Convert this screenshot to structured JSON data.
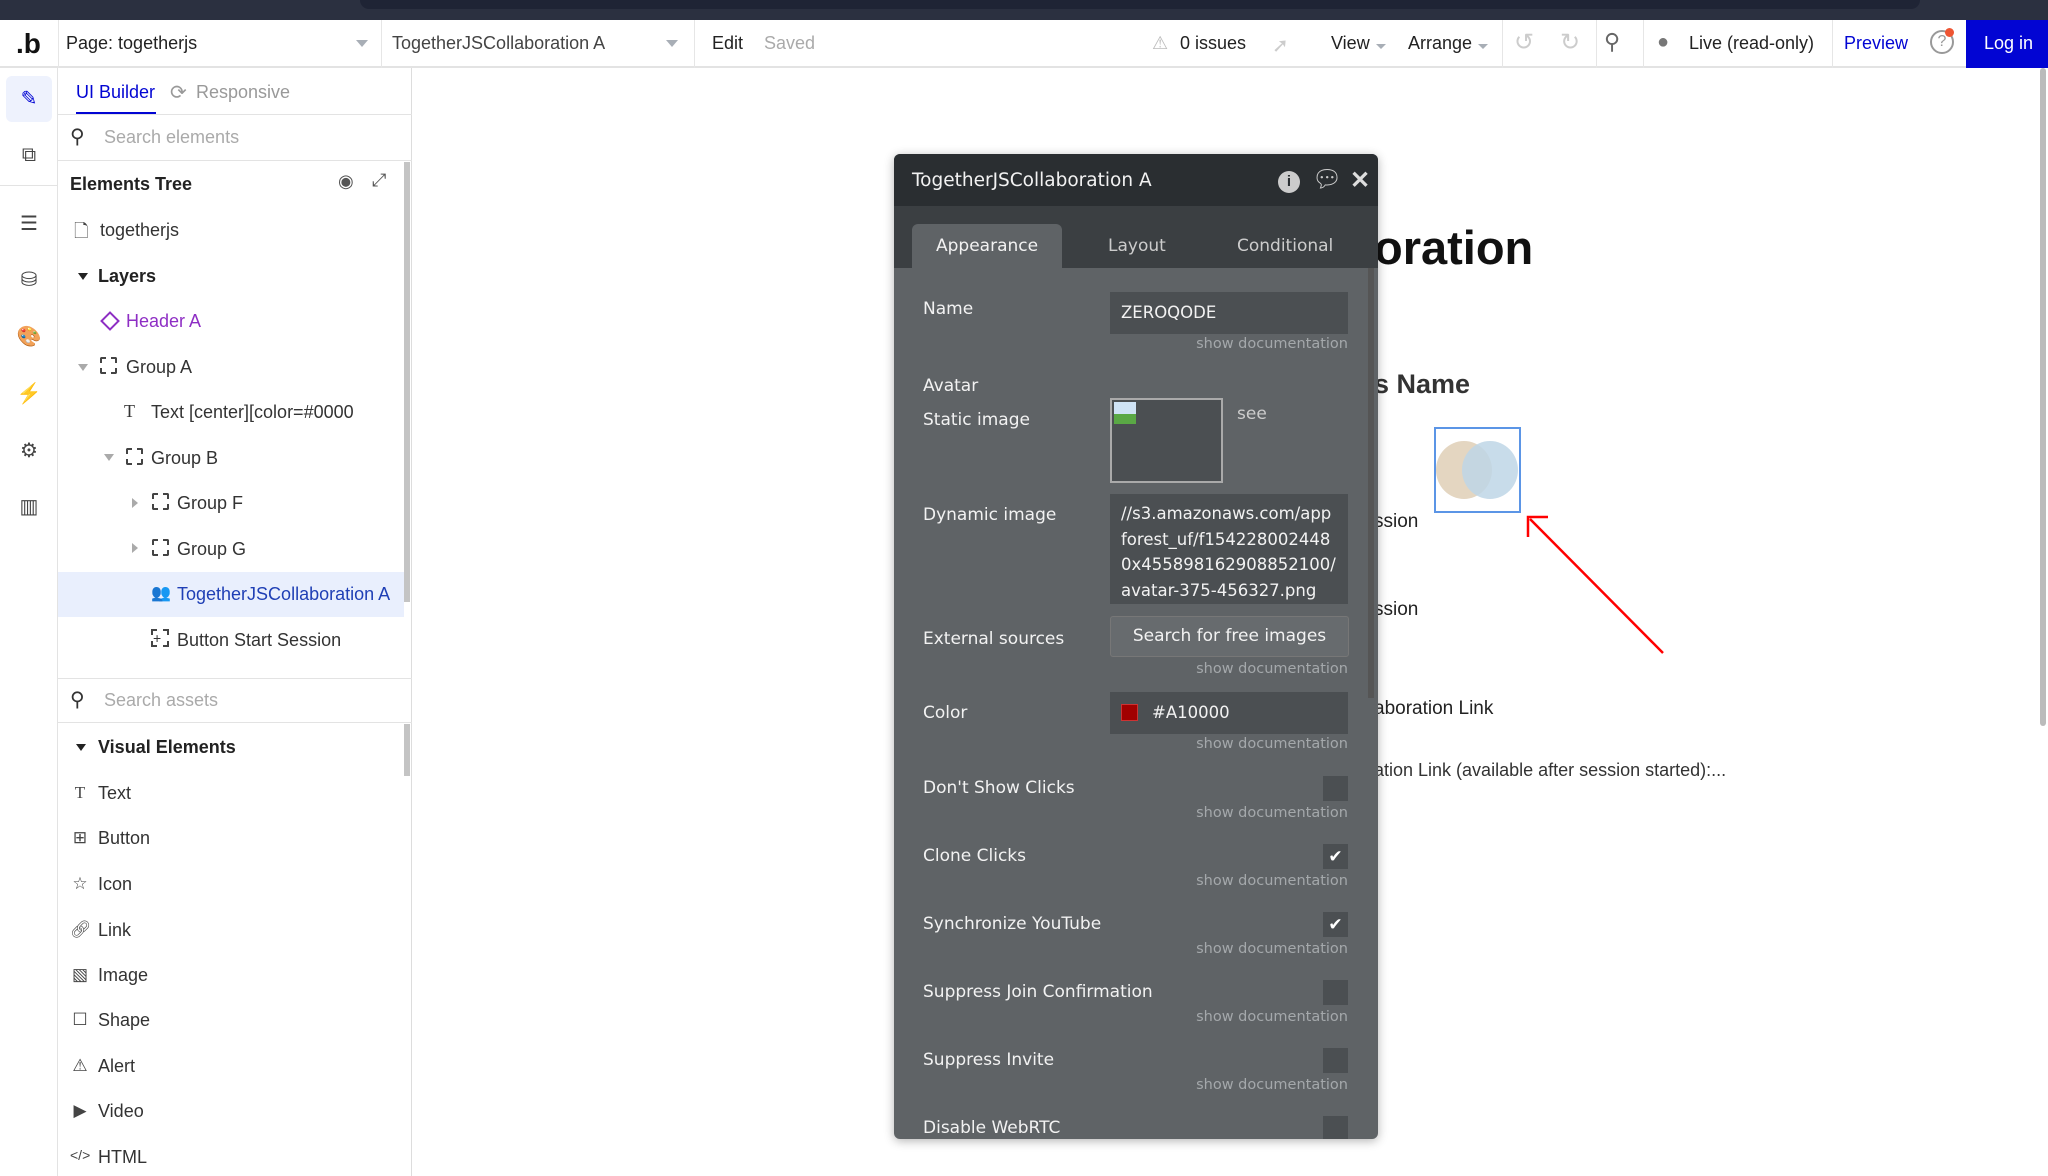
{
  "header": {
    "page_selector": "Page: togetherjs",
    "element_selector": "TogetherJSCollaboration A",
    "edit": "Edit",
    "saved": "Saved",
    "issues": "0 issues",
    "view": "View",
    "arrange": "Arrange",
    "live": "Live (read-only)",
    "preview": "Preview",
    "login": "Log in",
    "brand_color": "#0205D3",
    "preview_color": "#0205D3"
  },
  "left_panel": {
    "tabs": [
      "UI Builder",
      "Responsive"
    ],
    "search_elements_placeholder": "Search elements",
    "tree_title": "Elements Tree",
    "tree": [
      {
        "label": "togetherjs",
        "icon": "page-icon"
      },
      {
        "label": "Layers",
        "icon": "caret-down-icon"
      },
      {
        "label": "Header A",
        "icon": "reusable-diamond-icon"
      },
      {
        "label": "Group A",
        "icon": "group-icon"
      },
      {
        "label": "Text [center][color=#0000",
        "icon": "text-icon"
      },
      {
        "label": "Group B",
        "icon": "group-icon"
      },
      {
        "label": "Group F",
        "icon": "group-icon"
      },
      {
        "label": "Group G",
        "icon": "group-icon"
      },
      {
        "label": "TogetherJSCollaboration A",
        "icon": "users-icon",
        "selected": true
      },
      {
        "label": "Button Start Session",
        "icon": "button-icon"
      }
    ],
    "search_assets_placeholder": "Search assets",
    "visual_elements_title": "Visual Elements",
    "visual_elements": [
      "Text",
      "Button",
      "Icon",
      "Link",
      "Image",
      "Shape",
      "Alert",
      "Video",
      "HTML"
    ]
  },
  "canvas": {
    "title_fragment": "oration",
    "name_fragment": "s Name",
    "session_fragment_1": "ssion",
    "session_fragment_2": "ssion",
    "link_fragment": "aboration Link",
    "link_info_fragment": "ation Link (available after session started):..."
  },
  "dialog": {
    "title": "TogetherJSCollaboration A",
    "tabs": [
      "Appearance",
      "Layout",
      "Conditional"
    ],
    "active_tab": "Appearance",
    "doc_label": "show documentation",
    "name_label": "Name",
    "name_value": "ZEROQODE",
    "avatar_label": "Avatar",
    "static_image_label": "Static image",
    "see_label": "see",
    "dynamic_image_label": "Dynamic image",
    "dynamic_image_value": "//s3.amazonaws.com/appforest_uf/f1542280024480x455898162908852100/avatar-375-456327.png",
    "external_sources_label": "External sources",
    "search_images_button": "Search for free images",
    "color_label": "Color",
    "color_value": "#A10000",
    "checkboxes": [
      {
        "label": "Don't Show Clicks",
        "checked": false
      },
      {
        "label": "Clone Clicks",
        "checked": true
      },
      {
        "label": "Synchronize YouTube",
        "checked": true
      },
      {
        "label": "Suppress Join Confirmation",
        "checked": false
      },
      {
        "label": "Suppress Invite",
        "checked": false
      },
      {
        "label": "Disable WebRTC",
        "checked": false
      }
    ]
  }
}
